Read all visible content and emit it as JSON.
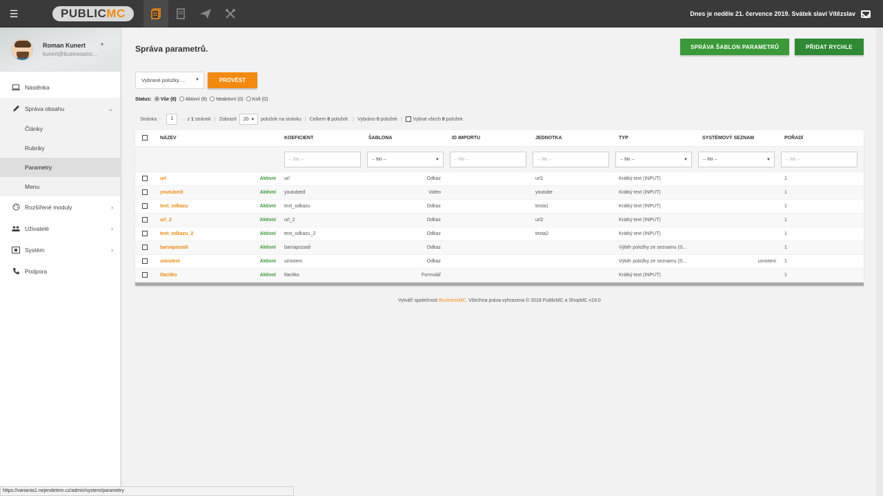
{
  "topbar": {
    "menu_icon": "hamburger-icon",
    "logo_part1": "PUBLIC",
    "logo_part2": "MC",
    "nav_icons": [
      "documents-icon",
      "page-icon",
      "send-icon",
      "tools-icon"
    ],
    "date_text": "Dnes je neděle 21. července 2019. Svátek slaví Vítězslav",
    "mail_icon": "mail-icon"
  },
  "user": {
    "name": "Roman Kunert",
    "email": "kunert@businessmc..."
  },
  "sidebar": {
    "items": [
      {
        "label": "Nástěnka",
        "icon": "laptop-icon"
      },
      {
        "label": "Správa obsahu",
        "icon": "pencil-icon"
      },
      {
        "label": "Rozšířené moduly",
        "icon": "palette-icon"
      },
      {
        "label": "Uživatelé",
        "icon": "users-icon"
      },
      {
        "label": "Systém",
        "icon": "system-icon"
      },
      {
        "label": "Podpora",
        "icon": "phone-icon"
      }
    ],
    "subitems": [
      "Články",
      "Rubriky",
      "Parametry",
      "Menu"
    ]
  },
  "page": {
    "title": "Správa parametrů.",
    "btn_templates": "SPRÁVA ŠABLON PARAMETRŮ",
    "btn_add": "PŘIDAT RYCHLE",
    "bulk_select": "Vybrané položky ...",
    "btn_execute": "PROVÉST"
  },
  "status": {
    "label": "Status:",
    "all": "Vše (8)",
    "active": "Aktivní (8)",
    "inactive": "Neaktivní (0)",
    "trash": "Koš (0)"
  },
  "pager": {
    "page_label": "Stránka",
    "page": "1",
    "of_pages_prefix": "z",
    "of_pages_count": "1",
    "of_pages_suffix": "stránek",
    "show_label": "Zobrazit",
    "per_page": "20",
    "per_page_suffix": "položek na stránku",
    "total_prefix": "Celkem",
    "total_count": "8",
    "total_suffix": "položek.",
    "selected_prefix": "Vybráno",
    "selected_count": "0",
    "selected_suffix": "položek",
    "select_all_prefix": "Vybrat všech",
    "select_all_count": "8",
    "select_all_suffix": "položek"
  },
  "table": {
    "headers": [
      "NÁZEV",
      "KOEFICIENT",
      "ŠABLONA",
      "ID IMPORTU",
      "JEDNOTKA",
      "TYP",
      "SYSTÉMOVÝ SEZNAM",
      "POŘADÍ"
    ],
    "filter_placeholder": "-- filtr --",
    "filter_select": "-- filtr --",
    "rows": [
      {
        "name": "url",
        "status": "Aktivní",
        "coef": "url",
        "template": "Odkaz",
        "import_id": "",
        "unit": "url1",
        "type": "Krátký text (INPUT)",
        "syslist": "",
        "order": "1"
      },
      {
        "name": "youtubeid",
        "status": "Aktivní",
        "coef": "youtubeid",
        "template": "Video",
        "import_id": "",
        "unit": "youtube",
        "type": "Krátký text (INPUT)",
        "syslist": "",
        "order": "1"
      },
      {
        "name": "text_odkazu",
        "status": "Aktivní",
        "coef": "text_odkazu",
        "template": "Odkaz",
        "import_id": "",
        "unit": "texta1",
        "type": "Krátký text (INPUT)",
        "syslist": "",
        "order": "1"
      },
      {
        "name": "url_2",
        "status": "Aktivní",
        "coef": "url_2",
        "template": "Odkaz",
        "import_id": "",
        "unit": "url2",
        "type": "Krátký text (INPUT)",
        "syslist": "",
        "order": "1"
      },
      {
        "name": "text_odkazu_2",
        "status": "Aktivní",
        "coef": "text_odkazu_2",
        "template": "Odkaz",
        "import_id": "",
        "unit": "texta2",
        "type": "Krátký text (INPUT)",
        "syslist": "",
        "order": "1"
      },
      {
        "name": "barvapozadi",
        "status": "Aktivní",
        "coef": "barvapozadi",
        "template": "Odkaz",
        "import_id": "",
        "unit": "",
        "type": "Výběr položky ze seznamu (S...",
        "syslist": "",
        "order": "1"
      },
      {
        "name": "umisteni",
        "status": "Aktivní",
        "coef": "umisteni",
        "template": "Odkaz",
        "import_id": "",
        "unit": "",
        "type": "Výběr položky ze seznamu (S...",
        "syslist": "umisteni",
        "order": "1"
      },
      {
        "name": "tlacitko",
        "status": "Aktivní",
        "coef": "tlacitko",
        "template": "Formulář",
        "import_id": "",
        "unit": "",
        "type": "Krátký text (INPUT)",
        "syslist": "",
        "order": "1"
      }
    ]
  },
  "footer": {
    "prefix": "Vytváří společnost",
    "brand": "BusinessMC",
    "suffix": ". Všechna práva vyhrazena © 2018 PublicMC a ShopMC v19.0"
  },
  "statusbar": {
    "url": "https://varianta1.nejendetem.cz/admin/system/parametry"
  },
  "colors": {
    "accent_orange": "#f28a0f",
    "green": "#3a9a3a",
    "topbar": "#3a3a3a"
  }
}
